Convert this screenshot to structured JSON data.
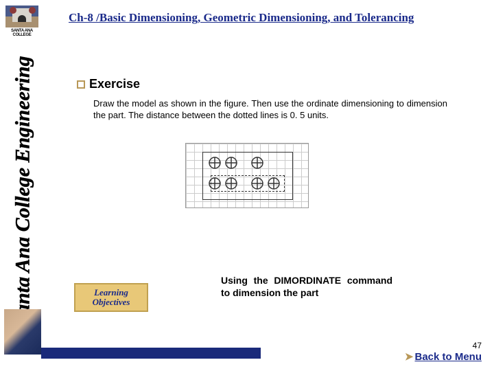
{
  "logo": {
    "name": "SANTA ANA COLLEGE"
  },
  "vertical_title": "Santa Ana College Engineering",
  "header": "Ch-8 /Basic Dimensioning, Geometric Dimensioning, and Tolerancing",
  "section": {
    "title": "Exercise",
    "body": "Draw the model as shown in the figure. Then use the ordinate dimensioning to dimension the part. The distance between the dotted lines is 0. 5 units."
  },
  "learning_box": {
    "line1": "Learning",
    "line2": "Objectives"
  },
  "caption": "Using the DIMORDINATE command to dimension the part",
  "page_number": "47",
  "back_link": "Back to Menu"
}
